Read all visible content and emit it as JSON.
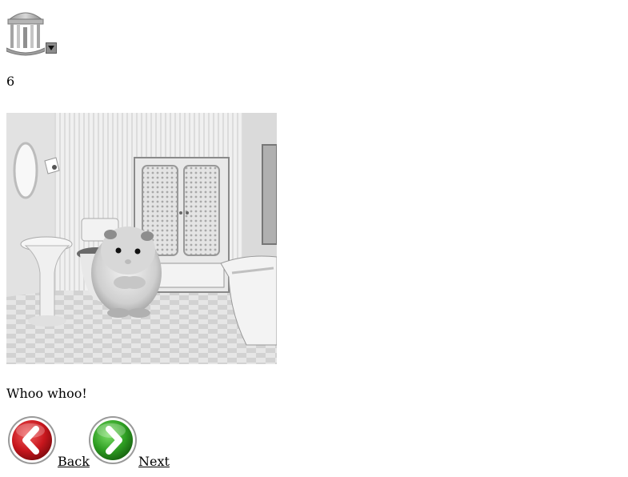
{
  "logo": {
    "icon": "old-well-icon"
  },
  "menu": {
    "icon": "dropdown-arrow-icon"
  },
  "page_number": "6",
  "image": {
    "subject": "hamster-in-dollhouse-bathroom"
  },
  "caption": "Whoo whoo!",
  "navigation": {
    "back_label": "Back",
    "next_label": "Next",
    "back_icon": "back-arrow-icon",
    "next_icon": "next-arrow-icon",
    "back_color": "#c8161d",
    "next_color": "#2e9e22"
  }
}
